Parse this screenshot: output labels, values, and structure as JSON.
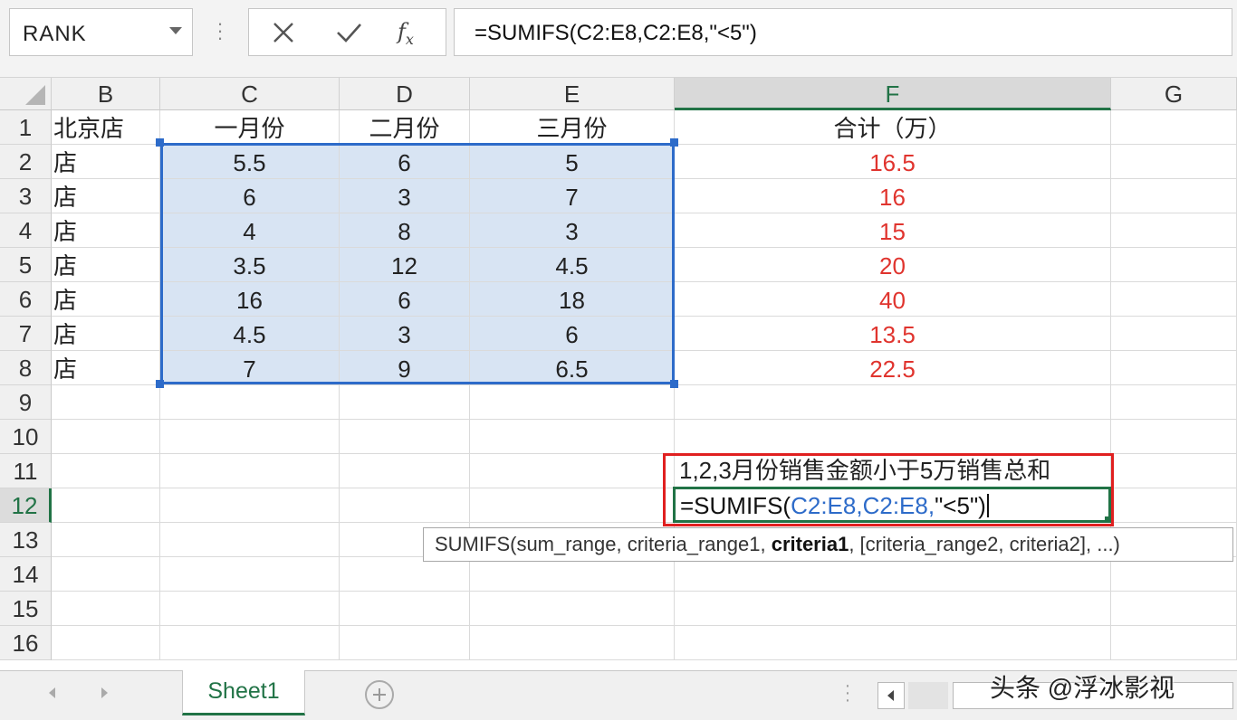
{
  "formula_bar": {
    "name_box": "RANK",
    "formula": "=SUMIFS(C2:E8,C2:E8,\"<5\")"
  },
  "columns": [
    "B",
    "C",
    "D",
    "E",
    "F",
    "G"
  ],
  "rows": [
    "1",
    "2",
    "3",
    "4",
    "5",
    "6",
    "7",
    "8",
    "9",
    "10",
    "11",
    "12",
    "13",
    "14",
    "15",
    "16"
  ],
  "table": {
    "headers": [
      "北京店",
      "一月份",
      "二月份",
      "三月份",
      "合计（万）"
    ],
    "rows": [
      [
        "店",
        "5.5",
        "6",
        "5",
        "16.5"
      ],
      [
        "店",
        "6",
        "3",
        "7",
        "16"
      ],
      [
        "店",
        "4",
        "8",
        "3",
        "15"
      ],
      [
        "店",
        "3.5",
        "12",
        "4.5",
        "20"
      ],
      [
        "店",
        "16",
        "6",
        "18",
        "40"
      ],
      [
        "店",
        "4.5",
        "3",
        "6",
        "13.5"
      ],
      [
        "店",
        "7",
        "9",
        "6.5",
        "22.5"
      ]
    ]
  },
  "note": "1,2,3月份销售金额小于5万销售总和",
  "edit": {
    "prefix": "=SUMIFS(",
    "ref1": "C2:E8",
    "comma": ",",
    "ref2": "C2:E8,",
    "suffix": "\"<5\")"
  },
  "tooltip": {
    "before": "SUMIFS(sum_range, criteria_range1, ",
    "bold": "criteria1",
    "after": ", [criteria_range2, criteria2], ...)"
  },
  "sheet_tab": "Sheet1",
  "watermark": "头条 @浮冰影视",
  "colors": {
    "accent": "#217346",
    "selection": "#2d6bc9",
    "red_value": "#e0342e",
    "highlight_box": "#e02020"
  }
}
